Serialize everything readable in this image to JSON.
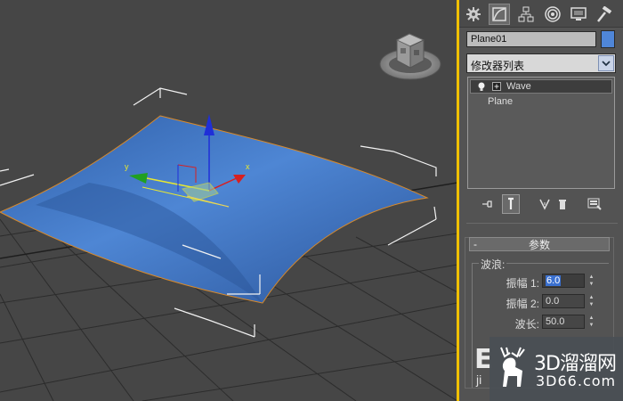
{
  "command_panel": {
    "tabs": [
      {
        "name": "create-tab",
        "icon": "sun-gear-icon"
      },
      {
        "name": "modify-tab",
        "icon": "bend-curve-icon"
      },
      {
        "name": "hierarchy-tab",
        "icon": "hierarchy-icon"
      },
      {
        "name": "motion-tab",
        "icon": "target-rings-icon"
      },
      {
        "name": "display-tab",
        "icon": "monitor-icon"
      },
      {
        "name": "utilities-tab",
        "icon": "hammer-icon"
      }
    ],
    "object_name": "Plane01",
    "object_color": "#4f86d8",
    "modifier_list_placeholder": "修改器列表",
    "stack": [
      {
        "label": "Wave",
        "selected": true
      },
      {
        "label": "Plane",
        "selected": false
      }
    ]
  },
  "parameters": {
    "rollout_title": "参数",
    "group_title": "波浪:",
    "amplitude1_label": "振幅 1:",
    "amplitude1_value": "6.0",
    "amplitude2_label": "振幅 2:",
    "amplitude2_value": "0.0",
    "wavelength_label": "波长:",
    "wavelength_value": "50.0"
  },
  "viewport": {
    "gizmo_x_label": "x",
    "gizmo_y_label": "y",
    "viewcube_label": "ViewCube"
  },
  "watermark": {
    "big": "E",
    "small": "ji",
    "cn": "3D溜溜网",
    "url": "3D66.com"
  },
  "colors": {
    "viewport_bg": "#464646",
    "plane": "#3f74c4",
    "active_border": "#f0c000",
    "panel_bg": "#535353"
  }
}
